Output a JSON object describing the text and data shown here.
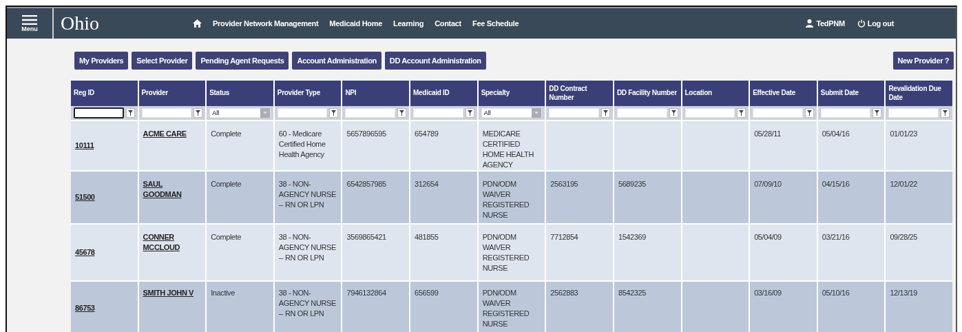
{
  "navbar": {
    "menu_label": "Menu",
    "logo": "Ohio",
    "links": [
      "Provider Network Management",
      "Medicaid Home",
      "Learning",
      "Contact",
      "Fee Schedule"
    ],
    "user": "TedPNM",
    "logout": "Log out"
  },
  "actions": [
    "My Providers",
    "Select Provider",
    "Pending Agent Requests",
    "Account Administration",
    "DD Account Administration"
  ],
  "new_provider": "New Provider ?",
  "table": {
    "columns": [
      "Reg ID",
      "Provider",
      "Status",
      "Provider Type",
      "NPI",
      "Medicaid ID",
      "Specialty",
      "DD Contract Number",
      "DD Facility Number",
      "Location",
      "Effective Date",
      "Submit Date",
      "Revalidation Due Date"
    ],
    "filters": [
      {
        "kind": "text",
        "focused": true
      },
      {
        "kind": "text",
        "focused": false
      },
      {
        "kind": "select",
        "value": "All",
        "focused": false
      },
      {
        "kind": "text",
        "focused": false
      },
      {
        "kind": "text",
        "focused": false
      },
      {
        "kind": "text",
        "focused": false
      },
      {
        "kind": "select",
        "value": "All",
        "focused": false
      },
      {
        "kind": "text",
        "focused": false
      },
      {
        "kind": "text",
        "focused": false
      },
      {
        "kind": "text",
        "focused": false
      },
      {
        "kind": "text",
        "focused": false
      },
      {
        "kind": "text",
        "focused": false
      },
      {
        "kind": "text",
        "focused": false
      }
    ],
    "rows": [
      [
        "10111",
        "ACME CARE",
        "Complete",
        "60 - Medicare Certified Home Health Agency",
        "5657896595",
        "654789",
        "MEDICARE CERTIFIED HOME HEALTH AGENCY",
        "",
        "",
        "",
        "05/28/11",
        "05/04/16",
        "01/01/23"
      ],
      [
        "51500",
        "SAUL GOODMAN",
        "Complete",
        "38 - NON-AGENCY NURSE -- RN OR LPN",
        "6542857985",
        "312654",
        "PDN/ODM WAIVER REGISTERED NURSE",
        "2563195",
        "5689235",
        "",
        "07/09/10",
        "04/15/16",
        "12/01/22"
      ],
      [
        "45678",
        "CONNER MCCLOUD",
        "Complete",
        "38 - NON-AGENCY NURSE -- RN OR LPN",
        "3569865421",
        "481855",
        "PDN/ODM WAIVER REGISTERED NURSE",
        "7712854",
        "1542369",
        "",
        "05/04/09",
        "03/21/16",
        "09/28/25"
      ],
      [
        "86753",
        "SMITH JOHN V",
        "Inactive",
        "38 - NON-AGENCY NURSE -- RN OR LPN",
        "7946132864",
        "656599",
        "PDN/ODM WAIVER REGISTERED NURSE",
        "2562883",
        "8542325",
        "",
        "03/16/09",
        "05/10/16",
        "12/13/19"
      ]
    ]
  }
}
